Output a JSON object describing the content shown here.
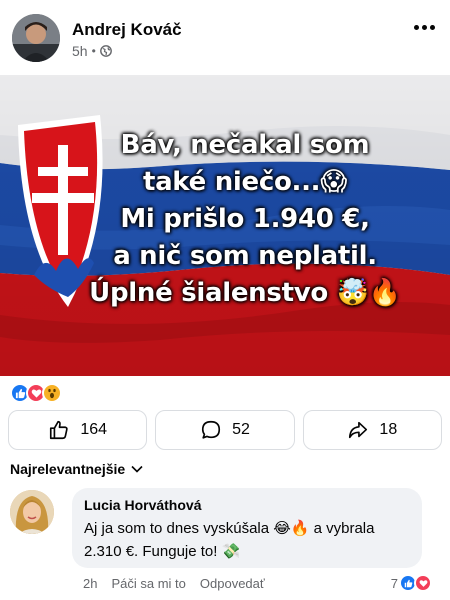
{
  "post": {
    "author": "Andrej Kováč",
    "time": "5h",
    "separator": "•",
    "image_text_lines": [
      "Báv, nečakal som",
      "také niečo...😱",
      "Mi prišlo 1.940 €,",
      "a nič som neplatil.",
      "Úplné šialenstvo 🤯🔥"
    ]
  },
  "reactions_icons": [
    "like-icon",
    "love-icon",
    "wow-icon"
  ],
  "actions": {
    "like_count": "164",
    "comment_count": "52",
    "share_count": "18"
  },
  "sort": {
    "label": "Najrelevantnejšie"
  },
  "comment": {
    "author": "Lucia Horváthová",
    "text_line1": "Aj ja som to dnes vyskúšala 😂🔥 a vybrala",
    "text_line2": "2.310 €. Funguje to! 💸",
    "time": "2h",
    "like_label": "Páči sa mi to",
    "reply_label": "Odpovedať",
    "reaction_count": "7"
  },
  "colors": {
    "like_blue": "#1877f2",
    "love_red": "#f33e58",
    "wow_yellow": "#f7b125",
    "muted_text": "#65676b",
    "bubble_bg": "#f0f2f5"
  }
}
